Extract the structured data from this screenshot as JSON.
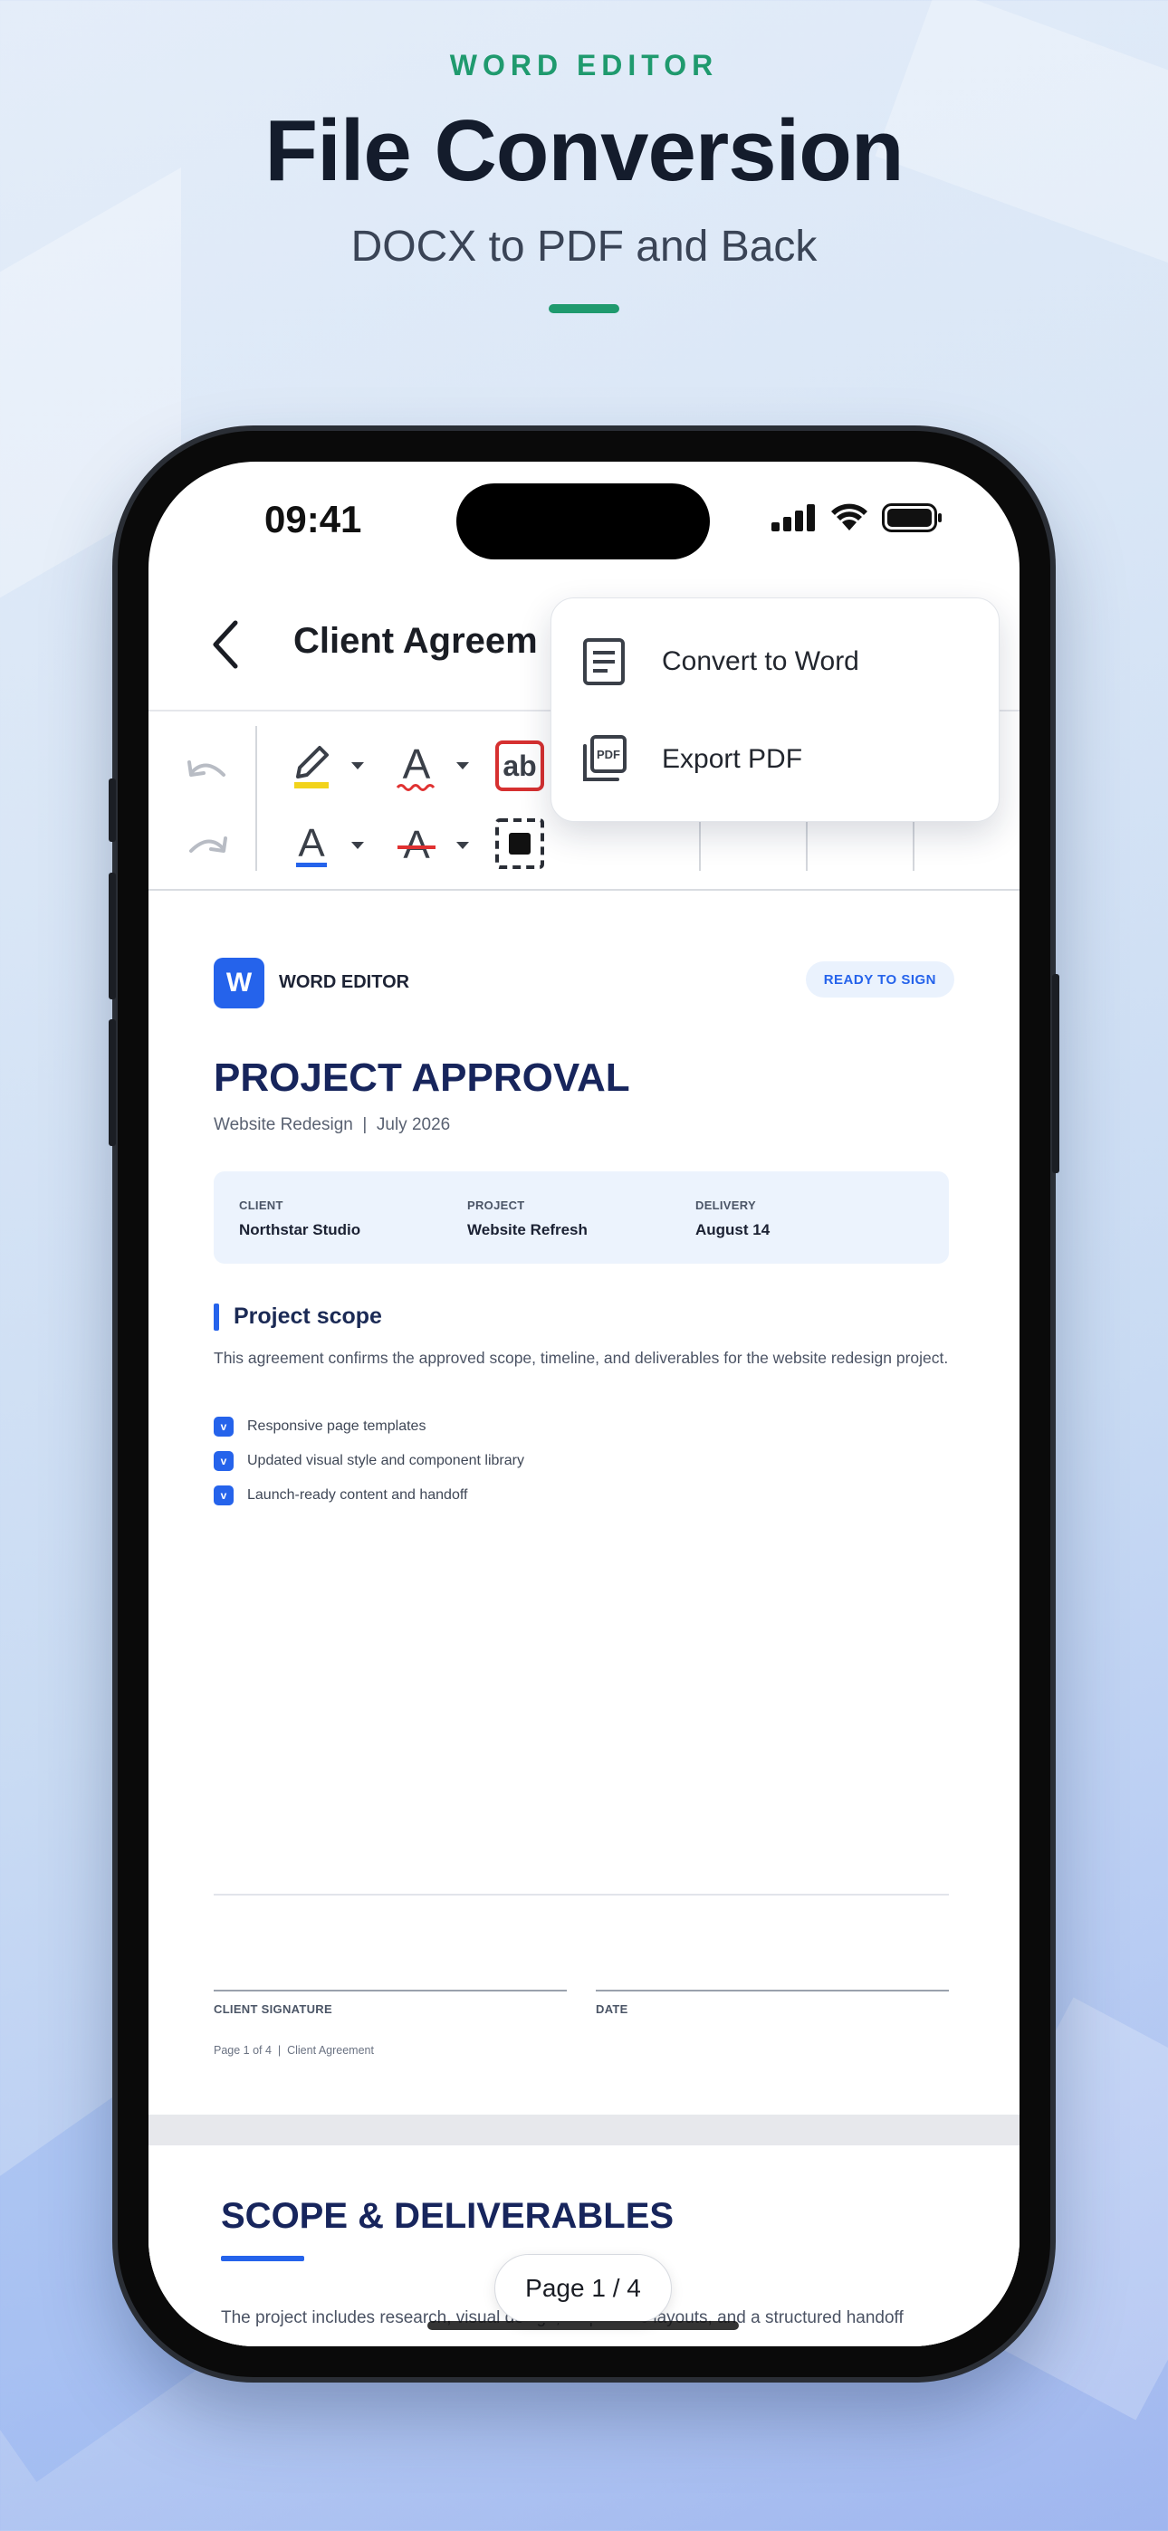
{
  "hero": {
    "eyebrow": "WORD EDITOR",
    "headline": "File Conversion",
    "subline": "DOCX to PDF and Back"
  },
  "status_bar": {
    "time": "09:41",
    "icons": [
      "signal-icon",
      "wifi-icon",
      "battery-icon"
    ]
  },
  "header": {
    "back_icon": "chevron-left-icon",
    "title": "Client Agreem"
  },
  "toolbar": {
    "icons": [
      "undo-icon",
      "redo-icon",
      "highlighter-icon",
      "font-color-icon",
      "spellcheck-icon",
      "text-color-icon",
      "strikethrough-icon",
      "select-frame-icon"
    ]
  },
  "menu": {
    "items": [
      {
        "label": "Convert to Word",
        "icon": "document-icon"
      },
      {
        "label": "Export PDF",
        "icon": "pdf-icon"
      }
    ]
  },
  "document": {
    "brand_logo_letter": "W",
    "brand_name": "WORD EDITOR",
    "badge": "READY TO SIGN",
    "title": "PROJECT APPROVAL",
    "subtitle": "Website Redesign  |  July 2026",
    "info": [
      {
        "key": "CLIENT",
        "value": "Northstar Studio"
      },
      {
        "key": "PROJECT",
        "value": "Website Refresh"
      },
      {
        "key": "DELIVERY",
        "value": "August 14"
      }
    ],
    "section_heading": "Project scope",
    "section_text": "This agreement confirms the approved scope, timeline, and deliverables for the website redesign project.",
    "checklist": [
      {
        "mark": "v",
        "text": "Responsive page templates"
      },
      {
        "mark": "v",
        "text": "Updated visual style and component library"
      },
      {
        "mark": "v",
        "text": "Launch-ready content and handoff"
      }
    ],
    "signature_label": "CLIENT SIGNATURE",
    "date_label": "DATE",
    "footer": "Page 1 of 4  |  Client Agreement"
  },
  "page2": {
    "title": "SCOPE & DELIVERABLES",
    "text": "The project includes research, visual design, responsive layouts, and a structured handoff"
  },
  "page_indicator": "Page 1 / 4",
  "colors": {
    "accent_green": "#1f9a6e",
    "brand_blue": "#2563eb",
    "navy_title": "#17255c"
  }
}
